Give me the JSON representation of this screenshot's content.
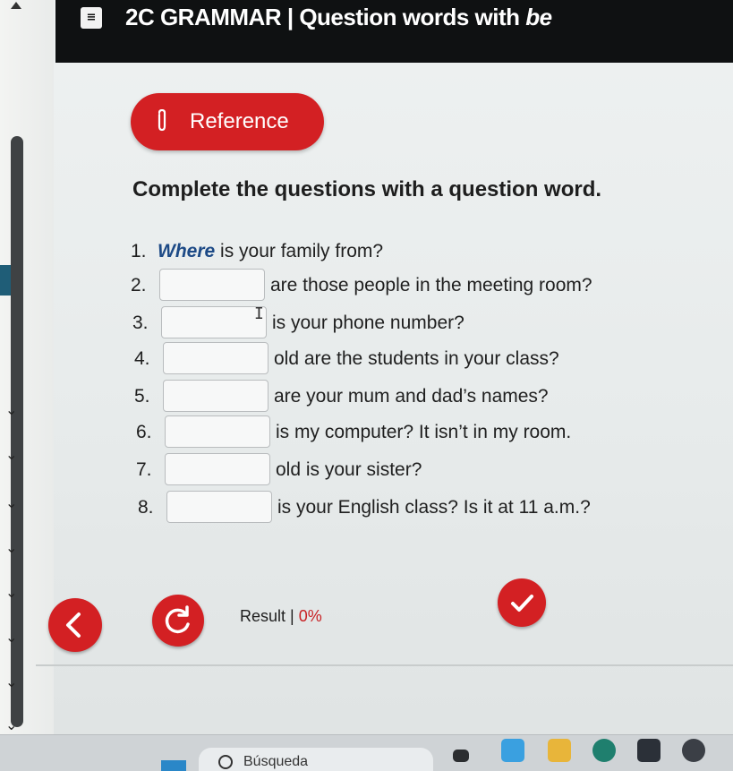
{
  "header": {
    "icon": "exercise-list-icon",
    "title_main": "2C GRAMMAR | Question words with ",
    "title_italic": "be"
  },
  "reference_button": {
    "icon": "paperclip-icon",
    "label": "Reference"
  },
  "instruction": "Complete the questions with a question word.",
  "questions": [
    {
      "num": "1.",
      "answer": "Where",
      "text": "is your family from?"
    },
    {
      "num": "2.",
      "value": "",
      "text": "are those people in the meeting room?"
    },
    {
      "num": "3.",
      "value": "",
      "text": "is your phone number?"
    },
    {
      "num": "4.",
      "value": "",
      "text": "old are the students in your class?"
    },
    {
      "num": "5.",
      "value": "",
      "text": "are your mum and dad’s names?"
    },
    {
      "num": "6.",
      "value": "",
      "text": "is my computer? It isn’t in my room."
    },
    {
      "num": "7.",
      "value": "",
      "text": "old is your sister?"
    },
    {
      "num": "8.",
      "value": "",
      "text": "is your English class? Is it at 11 a.m.?"
    }
  ],
  "footer": {
    "back_icon": "chevron-left-icon",
    "reset_icon": "reload-icon",
    "check_icon": "checkmark-icon",
    "result_label": "Result | ",
    "result_value": "0%"
  },
  "taskbar": {
    "search_label": "Búsqueda"
  },
  "colors": {
    "accent_red": "#d32023",
    "header_bg": "#0f1112",
    "answer_blue": "#1d4a86"
  }
}
